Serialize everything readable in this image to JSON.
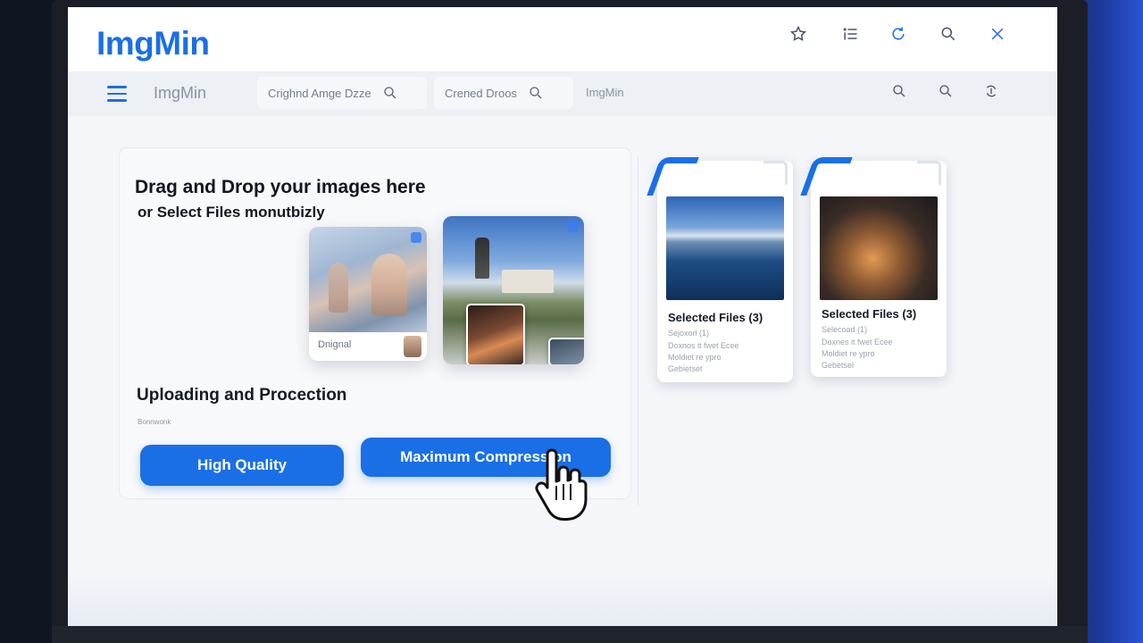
{
  "app": {
    "logo": "ImgMin"
  },
  "titlebar": {
    "icons": [
      "star-icon",
      "list-icon",
      "refresh-icon",
      "search-icon",
      "close-icon"
    ]
  },
  "nav": {
    "title": "ImgMin",
    "search1_placeholder": "Crighnd Amge Dzze",
    "search2_placeholder": "Crened Droos",
    "link": "ImgMin",
    "icons": [
      "search-icon",
      "search-icon",
      "sync-icon"
    ]
  },
  "upload": {
    "drop_title": "Drag and Drop your images here",
    "drop_subtitle": "or Select Files monutbizly",
    "thumb_left_label": "Dnignal",
    "section_title": "Uploading and Procection",
    "section_caption": "Bonnwonk",
    "btn_high_quality": "High Quality",
    "btn_max_compression": "Maximum Compression"
  },
  "files": [
    {
      "title": "Selected Files (3)",
      "lines": [
        "Sejoxorl (1)",
        "Doxnos it fwet Ecee",
        "Moldiet re ypro",
        "Gebietset"
      ]
    },
    {
      "title": "Selected Files (3)",
      "lines": [
        "Selecoad (1)",
        "Doxnes it fwet Ecee",
        "Moldiet re ypro",
        "Gebetsel"
      ]
    }
  ],
  "colors": {
    "accent": "#1a6fe6",
    "text": "#111622",
    "bg": "#f4f6fa"
  }
}
